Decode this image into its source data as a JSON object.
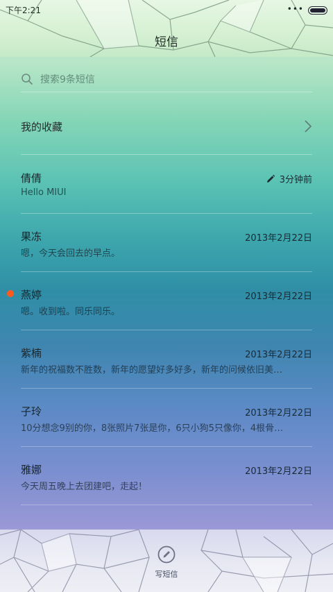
{
  "status_bar": {
    "time": "下午2:21",
    "indicator": "•••"
  },
  "header": {
    "title": "短信"
  },
  "search": {
    "placeholder": "搜索9条短信"
  },
  "favorites": {
    "label": "我的收藏"
  },
  "conversations": [
    {
      "name": "倩倩",
      "preview": "Hello MIUI",
      "time": "3分钟前",
      "draft": true,
      "unread": false
    },
    {
      "name": "果冻",
      "preview": "嗯，今天会回去的早点。",
      "time": "2013年2月22日",
      "draft": false,
      "unread": false
    },
    {
      "name": "燕婷",
      "preview": "嗯。收到啦。同乐同乐。",
      "time": "2013年2月22日",
      "draft": false,
      "unread": true
    },
    {
      "name": "紫楠",
      "preview": "新年的祝福数不胜数，新年的愿望好多好多，新年的问候依旧美…",
      "time": "2013年2月22日",
      "draft": false,
      "unread": false
    },
    {
      "name": "子玲",
      "preview": "10分想念9别的你，8张照片7张是你，6只小狗5只像你，4根骨…",
      "time": "2013年2月22日",
      "draft": false,
      "unread": false
    },
    {
      "name": "雅娜",
      "preview": "今天周五晚上去团建吧，走起！",
      "time": "2013年2月22日",
      "draft": false,
      "unread": false
    }
  ],
  "compose": {
    "label": "写短信",
    "icon": "compose-icon"
  },
  "colors": {
    "unread_dot": "#ff5a1e"
  }
}
